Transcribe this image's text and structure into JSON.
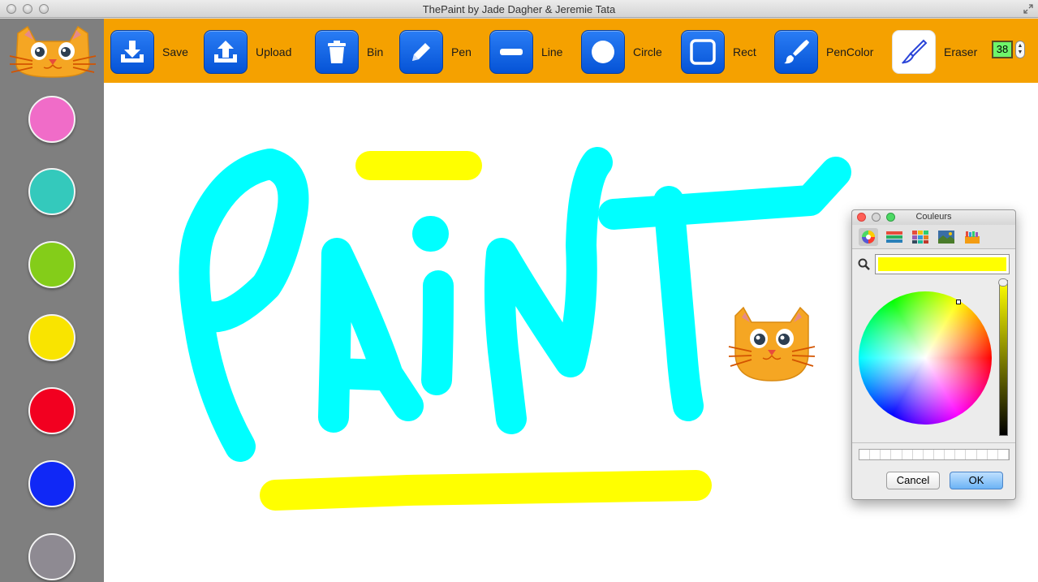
{
  "window": {
    "title": "ThePaint by Jade Dagher & Jeremie Tata"
  },
  "toolbar": {
    "tools": [
      {
        "label": "Save",
        "icon": "download-tray-icon"
      },
      {
        "label": "Upload",
        "icon": "upload-tray-icon"
      },
      {
        "label": "Bin",
        "icon": "trash-bin-icon"
      },
      {
        "label": "Pen",
        "icon": "pencil-icon"
      },
      {
        "label": "Line",
        "icon": "line-icon"
      },
      {
        "label": "Circle",
        "icon": "circle-icon"
      },
      {
        "label": "Rect",
        "icon": "rectangle-icon"
      },
      {
        "label": "PenColor",
        "icon": "paintbrush-icon"
      },
      {
        "label": "Eraser",
        "icon": "scalpel-icon"
      }
    ],
    "size_value": "38",
    "background_color": "#f5a100",
    "button_color": "#0a64e8"
  },
  "sidebar": {
    "logo_icon": "cat-face-icon",
    "swatches": [
      {
        "name": "pink",
        "color": "#f06cc8"
      },
      {
        "name": "teal",
        "color": "#34c9bc"
      },
      {
        "name": "green",
        "color": "#84cd19"
      },
      {
        "name": "yellow",
        "color": "#f9e400"
      },
      {
        "name": "red",
        "color": "#f20020"
      },
      {
        "name": "blue",
        "color": "#1028f6"
      },
      {
        "name": "gray",
        "color": "#8e8a92"
      }
    ]
  },
  "canvas": {
    "stroke_colors": {
      "cyan": "#00ffff",
      "yellow": "#ffff00"
    },
    "sticker_icon": "cat-face-icon"
  },
  "color_panel": {
    "title": "Couleurs",
    "tab_icons": [
      "color-wheel-icon",
      "color-sliders-icon",
      "color-palettes-icon",
      "image-palettes-icon",
      "crayons-icon"
    ],
    "current_color": "#ffff00",
    "cancel_label": "Cancel",
    "ok_label": "OK"
  }
}
